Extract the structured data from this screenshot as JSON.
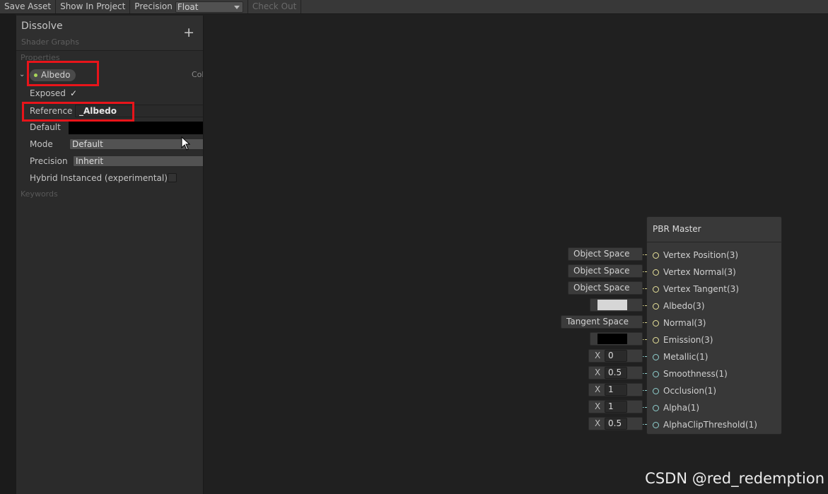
{
  "toolbar": {
    "save_asset": "Save Asset",
    "show_in_project": "Show In Project",
    "precision_label": "Precision",
    "precision_value": "Float",
    "check_out": "Check Out"
  },
  "blackboard": {
    "title": "Dissolve",
    "subtitle": "Shader Graphs",
    "add_icon": "+",
    "properties_label": "Properties",
    "keywords_label": "Keywords",
    "property": {
      "name": "Albedo",
      "type_truncated": "Col",
      "exposed_label": "Exposed",
      "exposed_checked": true,
      "reference_label": "Reference",
      "reference_value": "_Albedo",
      "default_label": "Default",
      "default_color": "#000000",
      "mode_label": "Mode",
      "mode_value": "Default",
      "precision_label": "Precision",
      "precision_value": "Inherit",
      "hybrid_label": "Hybrid Instanced (experimental)",
      "hybrid_checked": false
    }
  },
  "master_node": {
    "title": "PBR Master",
    "ports": [
      {
        "label": "Vertex Position(3)",
        "input": "Object Space",
        "kind": "space"
      },
      {
        "label": "Vertex Normal(3)",
        "input": "Object Space",
        "kind": "space"
      },
      {
        "label": "Vertex Tangent(3)",
        "input": "Object Space",
        "kind": "space"
      },
      {
        "label": "Albedo(3)",
        "input": "#d6d6d6",
        "kind": "color"
      },
      {
        "label": "Normal(3)",
        "input": "Tangent Space",
        "kind": "space"
      },
      {
        "label": "Emission(3)",
        "input": "#000000",
        "kind": "color"
      },
      {
        "label": "Metallic(1)",
        "input": "0",
        "kind": "float"
      },
      {
        "label": "Smoothness(1)",
        "input": "0.5",
        "kind": "float"
      },
      {
        "label": "Occlusion(1)",
        "input": "1",
        "kind": "float"
      },
      {
        "label": "Alpha(1)",
        "input": "1",
        "kind": "float"
      },
      {
        "label": "AlphaClipThreshold(1)",
        "input": "0.5",
        "kind": "float"
      }
    ],
    "x_axis_label": "X"
  },
  "watermark": "CSDN @red_redemption",
  "colors": {
    "annotation_red": "#e8141a",
    "vector3_port": "#e8e29a",
    "float_port": "#8fd0cf"
  }
}
